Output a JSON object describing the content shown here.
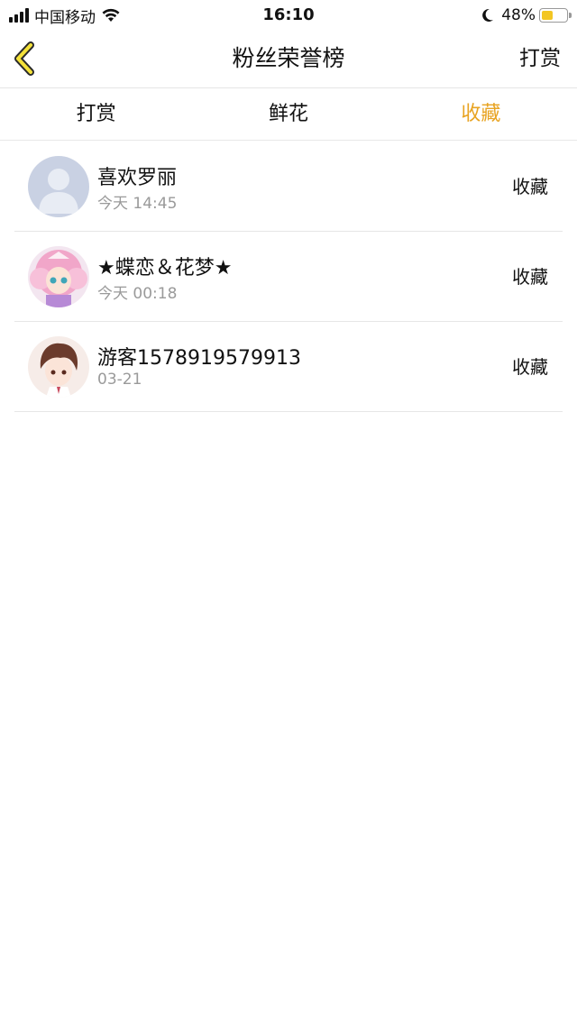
{
  "status_bar": {
    "carrier": "中国移动",
    "time": "16:10",
    "battery_percent": "48%",
    "battery_level": 0.48,
    "battery_color": "#f3c623",
    "icons": [
      "signal-icon",
      "wifi-icon",
      "moon-icon",
      "battery-icon"
    ]
  },
  "nav": {
    "back_icon": "chevron-left-icon",
    "title": "粉丝荣誉榜",
    "action_label": "打赏"
  },
  "tabs": [
    {
      "label": "打赏",
      "active": false
    },
    {
      "label": "鲜花",
      "active": false
    },
    {
      "label": "收藏",
      "active": true
    }
  ],
  "colors": {
    "accent": "#e8a321",
    "back_icon_fill": "#f4e23a",
    "secondary_text": "#9a9a9a"
  },
  "list": [
    {
      "name": "喜欢罗丽",
      "time": "今天 14:45",
      "action": "收藏",
      "avatar": "default-avatar"
    },
    {
      "name": "★蝶恋＆花梦★",
      "time": "今天 00:18",
      "action": "收藏",
      "avatar": "anime-girl-avatar"
    },
    {
      "name": "游客1578919579913",
      "time": "03-21",
      "action": "收藏",
      "avatar": "anime-boy-avatar"
    }
  ]
}
